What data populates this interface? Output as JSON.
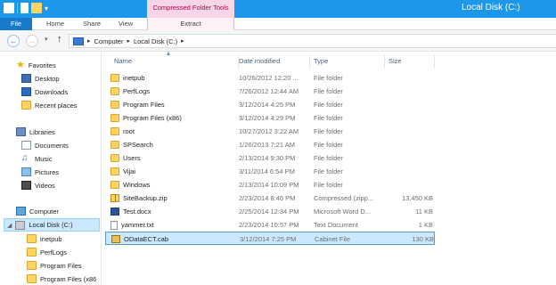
{
  "window": {
    "title": "Local Disk (C:)"
  },
  "ribbon": {
    "context_group": "Compressed Folder Tools",
    "tabs": {
      "file": "File",
      "home": "Home",
      "share": "Share",
      "view": "View",
      "extract": "Extract"
    }
  },
  "address": {
    "segments": [
      "Computer",
      "Local Disk (C:)"
    ]
  },
  "nav": {
    "favorites": {
      "label": "Favorites",
      "items": [
        "Desktop",
        "Downloads",
        "Recent places"
      ]
    },
    "libraries": {
      "label": "Libraries",
      "items": [
        "Documents",
        "Music",
        "Pictures",
        "Videos"
      ]
    },
    "computer": {
      "label": "Computer",
      "drive": "Local Disk (C:)",
      "children": [
        "inetpub",
        "PerfLogs",
        "Program Files",
        "Program Files (x86"
      ]
    }
  },
  "columns": {
    "name": "Name",
    "date": "Date modified",
    "type": "Type",
    "size": "Size"
  },
  "files": [
    {
      "name": "inetpub",
      "date": "10/26/2012 12:20 ...",
      "type": "File folder",
      "size": "",
      "icon": "folder"
    },
    {
      "name": "PerfLogs",
      "date": "7/26/2012 12:44 AM",
      "type": "File folder",
      "size": "",
      "icon": "folder"
    },
    {
      "name": "Program Files",
      "date": "3/12/2014 4:25 PM",
      "type": "File folder",
      "size": "",
      "icon": "folder"
    },
    {
      "name": "Program Files (x86)",
      "date": "3/12/2014 4:29 PM",
      "type": "File folder",
      "size": "",
      "icon": "folder"
    },
    {
      "name": "root",
      "date": "10/27/2012 3:22 AM",
      "type": "File folder",
      "size": "",
      "icon": "folder"
    },
    {
      "name": "SPSearch",
      "date": "1/26/2013 7:21 AM",
      "type": "File folder",
      "size": "",
      "icon": "folder"
    },
    {
      "name": "Users",
      "date": "2/13/2014 9:30 PM",
      "type": "File folder",
      "size": "",
      "icon": "folder"
    },
    {
      "name": "Vijai",
      "date": "3/11/2014 6:54 PM",
      "type": "File folder",
      "size": "",
      "icon": "folder"
    },
    {
      "name": "Windows",
      "date": "2/13/2014 10:09 PM",
      "type": "File folder",
      "size": "",
      "icon": "folder"
    },
    {
      "name": "SiteBackup.zip",
      "date": "2/23/2014 8:46 PM",
      "type": "Compressed (zipp...",
      "size": "13,450 KB",
      "icon": "zip"
    },
    {
      "name": "Test.docx",
      "date": "2/25/2014 12:34 PM",
      "type": "Microsoft Word D...",
      "size": "11 KB",
      "icon": "docx"
    },
    {
      "name": "yammer.txt",
      "date": "2/23/2014 10:57 PM",
      "type": "Text Document",
      "size": "1 KB",
      "icon": "txt"
    },
    {
      "name": "ODataECT.cab",
      "date": "3/12/2014 7:25 PM",
      "type": "Cabinet File",
      "size": "130 KB",
      "icon": "cab",
      "selected": true
    }
  ]
}
